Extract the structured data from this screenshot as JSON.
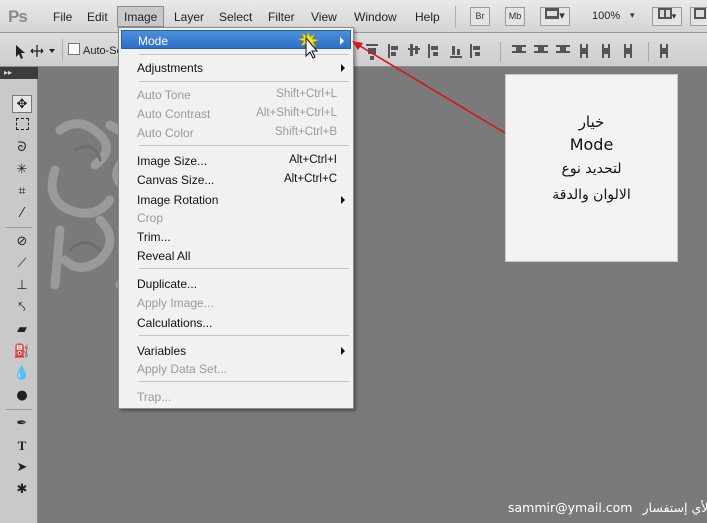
{
  "menubar": {
    "logo": "Ps",
    "items": [
      "File",
      "Edit",
      "Image",
      "Layer",
      "Select",
      "Filter",
      "View",
      "Window",
      "Help"
    ],
    "active": "Image",
    "bridge_button": "Br",
    "minibridge_button": "Mb",
    "zoom": "100%"
  },
  "options": {
    "auto_select_label": "Auto-Se"
  },
  "image_menu": {
    "rows": [
      {
        "label": "Mode",
        "shortcut": "",
        "submenu": true,
        "disabled": false,
        "highlighted": true
      },
      {
        "label": "Adjustments",
        "shortcut": "",
        "submenu": true,
        "disabled": false
      },
      {
        "label": "Auto Tone",
        "shortcut": "Shift+Ctrl+L",
        "disabled": true
      },
      {
        "label": "Auto Contrast",
        "shortcut": "Alt+Shift+Ctrl+L",
        "disabled": true
      },
      {
        "label": "Auto Color",
        "shortcut": "Shift+Ctrl+B",
        "disabled": true
      },
      {
        "label": "Image Size...",
        "shortcut": "Alt+Ctrl+I",
        "disabled": false
      },
      {
        "label": "Canvas Size...",
        "shortcut": "Alt+Ctrl+C",
        "disabled": false
      },
      {
        "label": "Image Rotation",
        "shortcut": "",
        "submenu": true,
        "disabled": false
      },
      {
        "label": "Crop",
        "shortcut": "",
        "disabled": true
      },
      {
        "label": "Trim...",
        "shortcut": "",
        "disabled": false
      },
      {
        "label": "Reveal All",
        "shortcut": "",
        "disabled": false
      },
      {
        "label": "Duplicate...",
        "shortcut": "",
        "disabled": false
      },
      {
        "label": "Apply Image...",
        "shortcut": "",
        "disabled": true
      },
      {
        "label": "Calculations...",
        "shortcut": "",
        "disabled": false
      },
      {
        "label": "Variables",
        "shortcut": "",
        "submenu": true,
        "disabled": false
      },
      {
        "label": "Apply Data Set...",
        "shortcut": "",
        "disabled": true
      },
      {
        "label": "Trap...",
        "shortcut": "",
        "disabled": true
      }
    ]
  },
  "callout": {
    "line1": "خيار",
    "line2": "Mode",
    "line3": "لتحديد نوع",
    "line4": "الالوان والدقة"
  },
  "footer": {
    "label": "لأي إستفسار",
    "email": "sammir@ymail.com"
  },
  "colors": {
    "canvas": "#7a7a7a",
    "highlight": "#3b7fd6",
    "arrow": "#d8141c",
    "callout_bg": "#f3f3f3"
  }
}
